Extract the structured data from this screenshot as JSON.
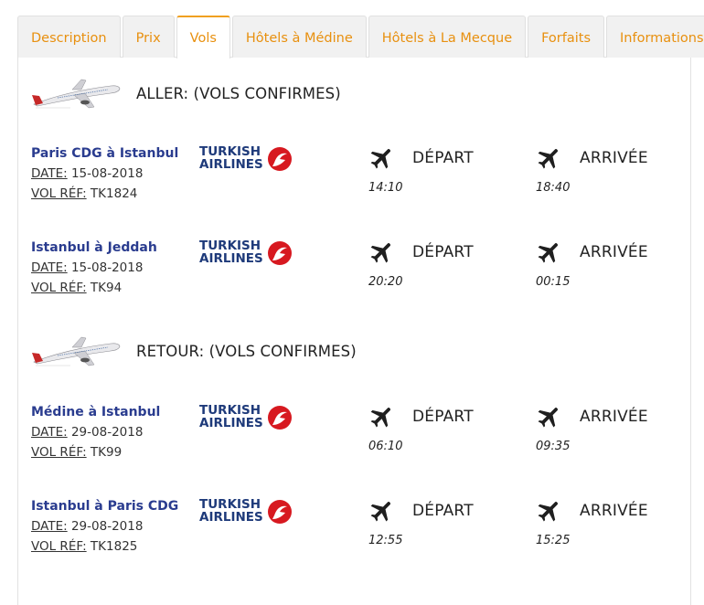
{
  "tabs": [
    {
      "label": "Description",
      "active": false
    },
    {
      "label": "Prix",
      "active": false
    },
    {
      "label": "Vols",
      "active": true
    },
    {
      "label": "Hôtels à Médine",
      "active": false
    },
    {
      "label": "Hôtels à La Mecque",
      "active": false
    },
    {
      "label": "Forfaits",
      "active": false
    },
    {
      "label": "Informations",
      "active": false
    }
  ],
  "colors": {
    "tab_text": "#e8900f",
    "route_text": "#2a3c8f",
    "logo_red": "#d71920",
    "logo_blue": "#1e3a7a"
  },
  "labels": {
    "date_key": "DATE:",
    "ref_key": "VOL RÉF:",
    "depart": "DÉPART",
    "arrivee": "ARRIVÉE"
  },
  "airline": {
    "line1": "TURKISH",
    "line2": "AIRLINES"
  },
  "sections": [
    {
      "title": "ALLER: (VOLS CONFIRMES)",
      "flights": [
        {
          "route": "Paris CDG à Istanbul",
          "date": "15-08-2018",
          "ref": "TK1824",
          "dep_time": "14:10",
          "arr_time": "18:40"
        },
        {
          "route": "Istanbul à Jeddah",
          "date": "15-08-2018",
          "ref": "TK94",
          "dep_time": "20:20",
          "arr_time": "00:15"
        }
      ]
    },
    {
      "title": "RETOUR: (VOLS CONFIRMES)",
      "flights": [
        {
          "route": "Médine à Istanbul",
          "date": "29-08-2018",
          "ref": "TK99",
          "dep_time": "06:10",
          "arr_time": "09:35"
        },
        {
          "route": "Istanbul à Paris CDG",
          "date": "29-08-2018",
          "ref": "TK1825",
          "dep_time": "12:55",
          "arr_time": "15:25"
        }
      ]
    }
  ]
}
